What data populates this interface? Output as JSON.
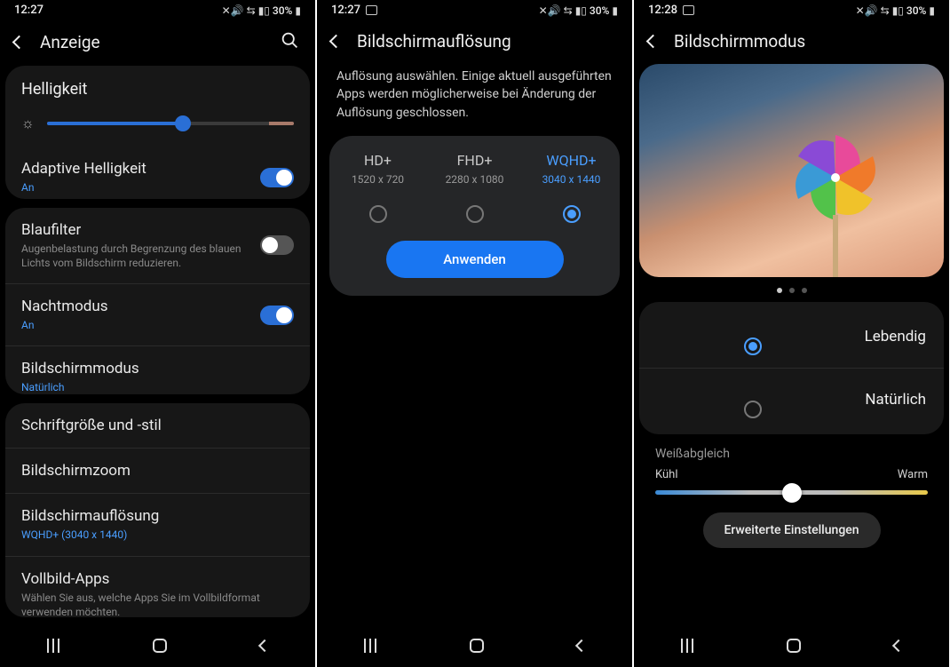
{
  "status": {
    "time_a": "12:27",
    "time_b": "12:27",
    "time_c": "12:28",
    "battery": "30%"
  },
  "screen1": {
    "title": "Anzeige",
    "brightness_label": "Helligkeit",
    "brightness_pct": 55,
    "adaptive": {
      "title": "Adaptive Helligkeit",
      "sub": "An",
      "on": true
    },
    "bluefilter": {
      "title": "Blaufilter",
      "sub": "Augenbelastung durch Begrenzung des blauen Lichts vom Bildschirm reduzieren.",
      "on": false
    },
    "nightmode": {
      "title": "Nachtmodus",
      "sub": "An",
      "on": true
    },
    "screenmode": {
      "title": "Bildschirmmodus",
      "sub": "Natürlich"
    },
    "fontsize": {
      "title": "Schriftgröße und -stil"
    },
    "zoom": {
      "title": "Bildschirmzoom"
    },
    "resolution": {
      "title": "Bildschirmauflösung",
      "sub": "WQHD+ (3040 x 1440)"
    },
    "fullscreen": {
      "title": "Vollbild-Apps",
      "sub": "Wählen Sie aus, welche Apps Sie im Vollbildformat verwenden möchten."
    }
  },
  "screen2": {
    "title": "Bildschirmauflösung",
    "description": "Auflösung auswählen. Einige aktuell ausgeführten Apps werden möglicherweise bei Änderung der Auflösung geschlossen.",
    "options": [
      {
        "name": "HD+",
        "dim": "1520 x 720",
        "selected": false
      },
      {
        "name": "FHD+",
        "dim": "2280 x 1080",
        "selected": false
      },
      {
        "name": "WQHD+",
        "dim": "3040 x 1440",
        "selected": true
      }
    ],
    "apply": "Anwenden"
  },
  "screen3": {
    "title": "Bildschirmmodus",
    "modes": [
      {
        "label": "Lebendig",
        "selected": true
      },
      {
        "label": "Natürlich",
        "selected": false
      }
    ],
    "wb_label": "Weißabgleich",
    "wb_cool": "Kühl",
    "wb_warm": "Warm",
    "wb_pct": 50,
    "advanced": "Erweiterte Einstellungen",
    "page_dots": 3,
    "page_active": 0
  }
}
